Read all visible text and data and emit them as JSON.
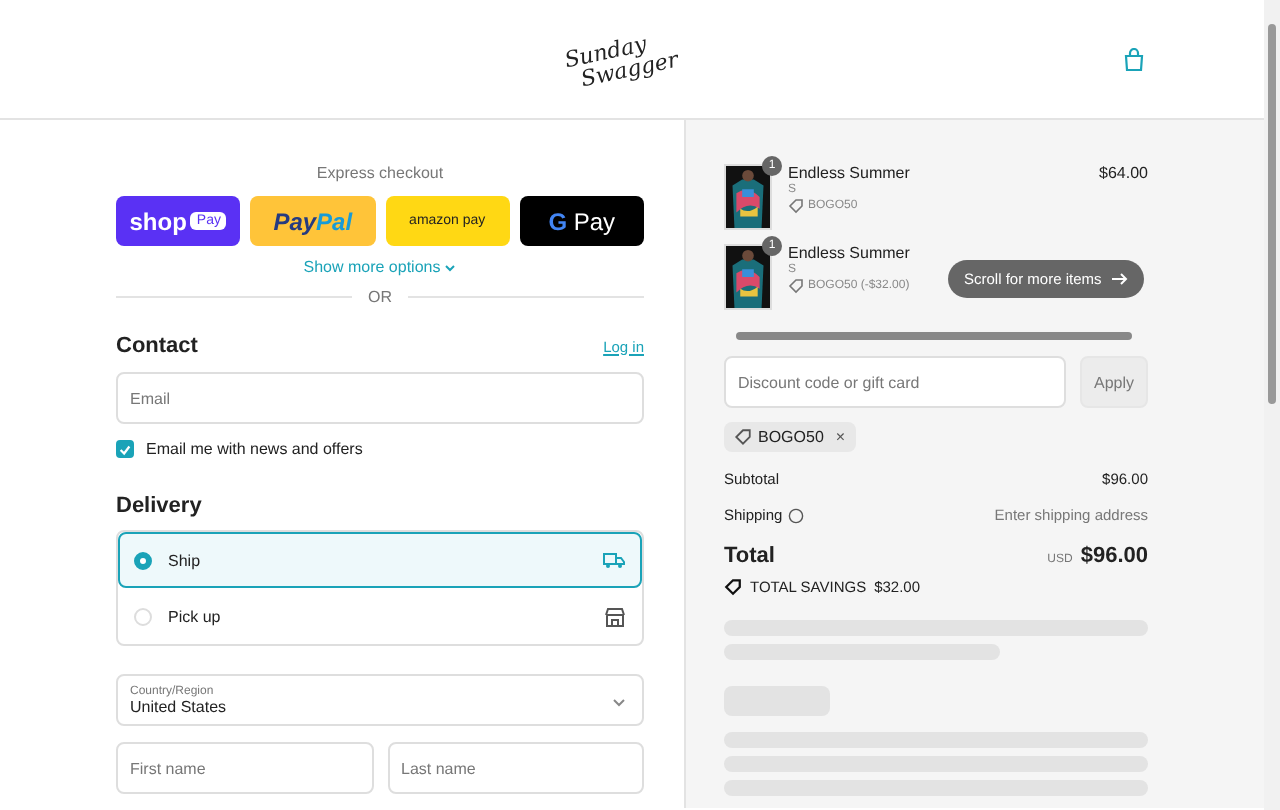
{
  "header": {
    "logo": [
      "Sunday",
      "Swagger"
    ]
  },
  "express": {
    "label": "Express checkout",
    "buttons": [
      {
        "kind": "shop",
        "text": "shop",
        "badge": "Pay"
      },
      {
        "kind": "paypal",
        "text": "Pay",
        "text2": "Pal"
      },
      {
        "kind": "amazon",
        "text": "amazon pay"
      },
      {
        "kind": "gpay",
        "text": "G",
        "text2": "Pay"
      }
    ],
    "more": "Show more options",
    "divider": "OR"
  },
  "contact": {
    "title": "Contact",
    "login": "Log in",
    "email_placeholder": "Email",
    "news": {
      "label": "Email me with news and offers",
      "checked": true
    }
  },
  "delivery": {
    "title": "Delivery",
    "options": [
      {
        "label": "Ship",
        "kind": "ship",
        "selected": true
      },
      {
        "label": "Pick up",
        "kind": "pickup",
        "selected": false
      }
    ],
    "country_label": "Country/Region",
    "country": "United States",
    "first_placeholder": "First name",
    "last_placeholder": "Last name"
  },
  "cart": {
    "items": [
      {
        "quantity": "1",
        "name": "Endless Summer",
        "variant": "S",
        "discount": "BOGO50",
        "price": "$64.00"
      },
      {
        "quantity": "1",
        "name": "Endless Summer",
        "variant": "S",
        "discount": "BOGO50 (-$32.00)"
      }
    ],
    "scroll_hint": "Scroll for more items",
    "discount_placeholder": "Discount code or gift card",
    "apply": "Apply",
    "code": "BOGO50",
    "remove": "×"
  },
  "summary": {
    "subtotal_label": "Subtotal",
    "subtotal": "$96.00",
    "shipping_label": "Shipping",
    "shipping": "Enter shipping address",
    "total_label": "Total",
    "currency": "USD",
    "total": "$96.00",
    "savings_label": "TOTAL SAVINGS",
    "savings": "$32.00"
  }
}
